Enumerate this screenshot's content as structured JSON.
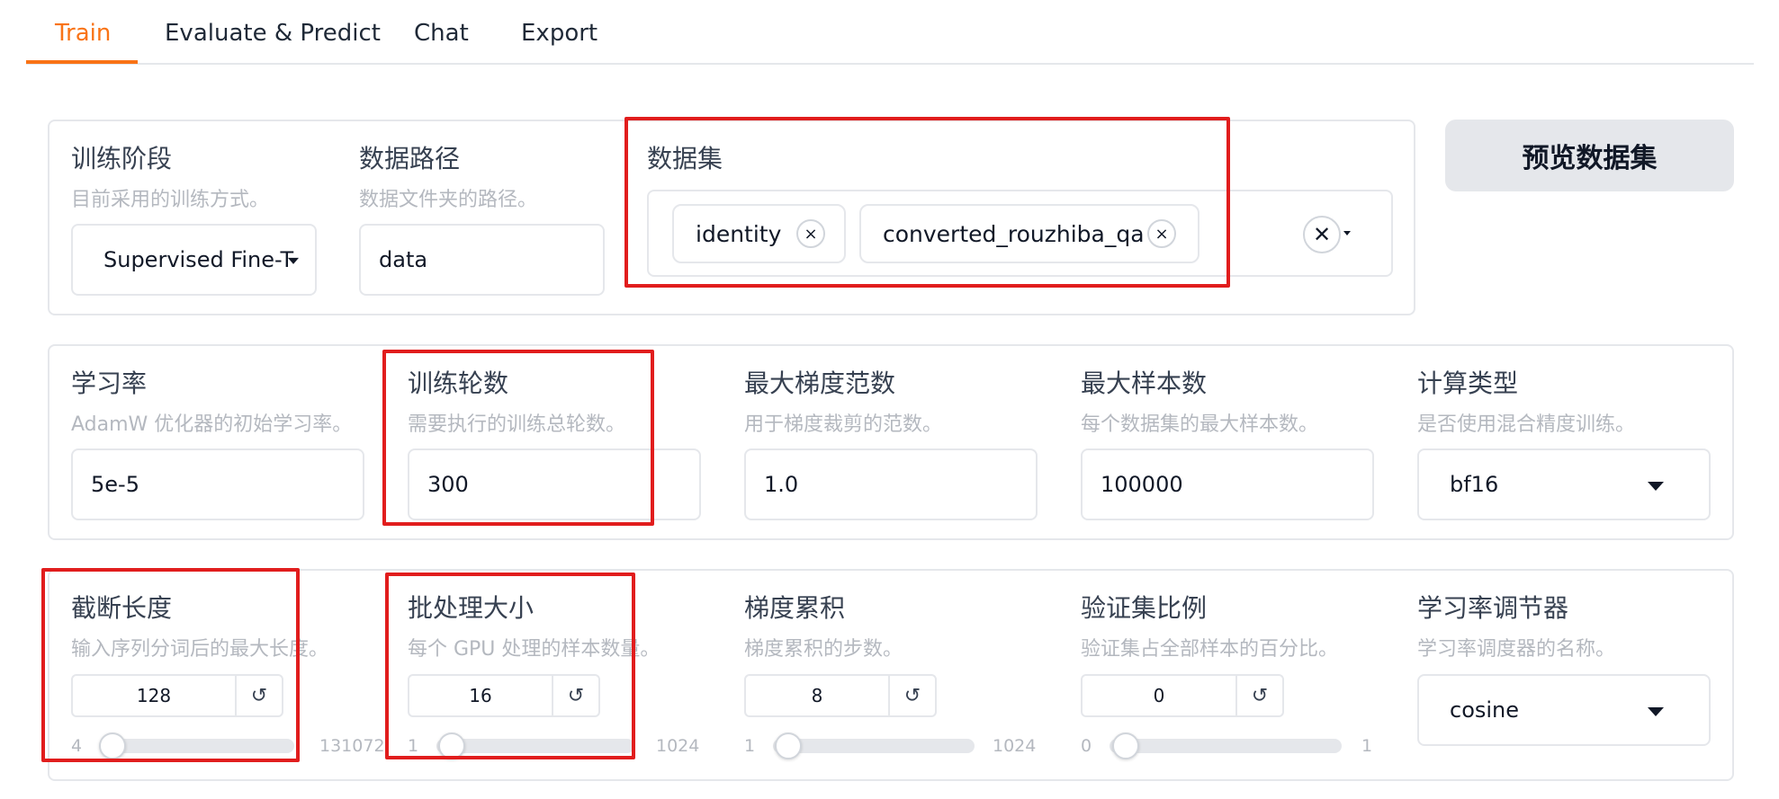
{
  "tabs": [
    "Train",
    "Evaluate & Predict",
    "Chat",
    "Export"
  ],
  "active_tab": "Train",
  "colors": {
    "accent": "#f97316",
    "highlight_box": "#e11d1d"
  },
  "row1": {
    "stage": {
      "label": "训练阶段",
      "info": "目前采用的训练方式。",
      "value": "Supervised Fine-T"
    },
    "dataset_dir": {
      "label": "数据路径",
      "info": "数据文件夹的路径。",
      "value": "data"
    },
    "dataset": {
      "label": "数据集",
      "chips": [
        "identity",
        "converted_rouzhiba_qa"
      ]
    },
    "preview_button": "预览数据集"
  },
  "row2": {
    "learning_rate": {
      "label": "学习率",
      "info": "AdamW 优化器的初始学习率。",
      "value": "5e-5"
    },
    "num_epochs": {
      "label": "训练轮数",
      "info": "需要执行的训练总轮数。",
      "value": "300"
    },
    "max_grad_norm": {
      "label": "最大梯度范数",
      "info": "用于梯度裁剪的范数。",
      "value": "1.0"
    },
    "max_samples": {
      "label": "最大样本数",
      "info": "每个数据集的最大样本数。",
      "value": "100000"
    },
    "compute_type": {
      "label": "计算类型",
      "info": "是否使用混合精度训练。",
      "value": "bf16"
    }
  },
  "row3": {
    "cutoff_len": {
      "label": "截断长度",
      "info": "输入序列分词后的最大长度。",
      "value": "128",
      "min": "4",
      "max": "131072"
    },
    "batch_size": {
      "label": "批处理大小",
      "info": "每个 GPU 处理的样本数量。",
      "value": "16",
      "min": "1",
      "max": "1024"
    },
    "grad_accum": {
      "label": "梯度累积",
      "info": "梯度累积的步数。",
      "value": "8",
      "min": "1",
      "max": "1024"
    },
    "val_size": {
      "label": "验证集比例",
      "info": "验证集占全部样本的百分比。",
      "value": "0",
      "min": "0",
      "max": "1"
    },
    "lr_scheduler": {
      "label": "学习率调节器",
      "info": "学习率调度器的名称。",
      "value": "cosine"
    }
  },
  "icons": {
    "chip_remove": "×",
    "reset": "↺",
    "clear_all": "✕"
  }
}
